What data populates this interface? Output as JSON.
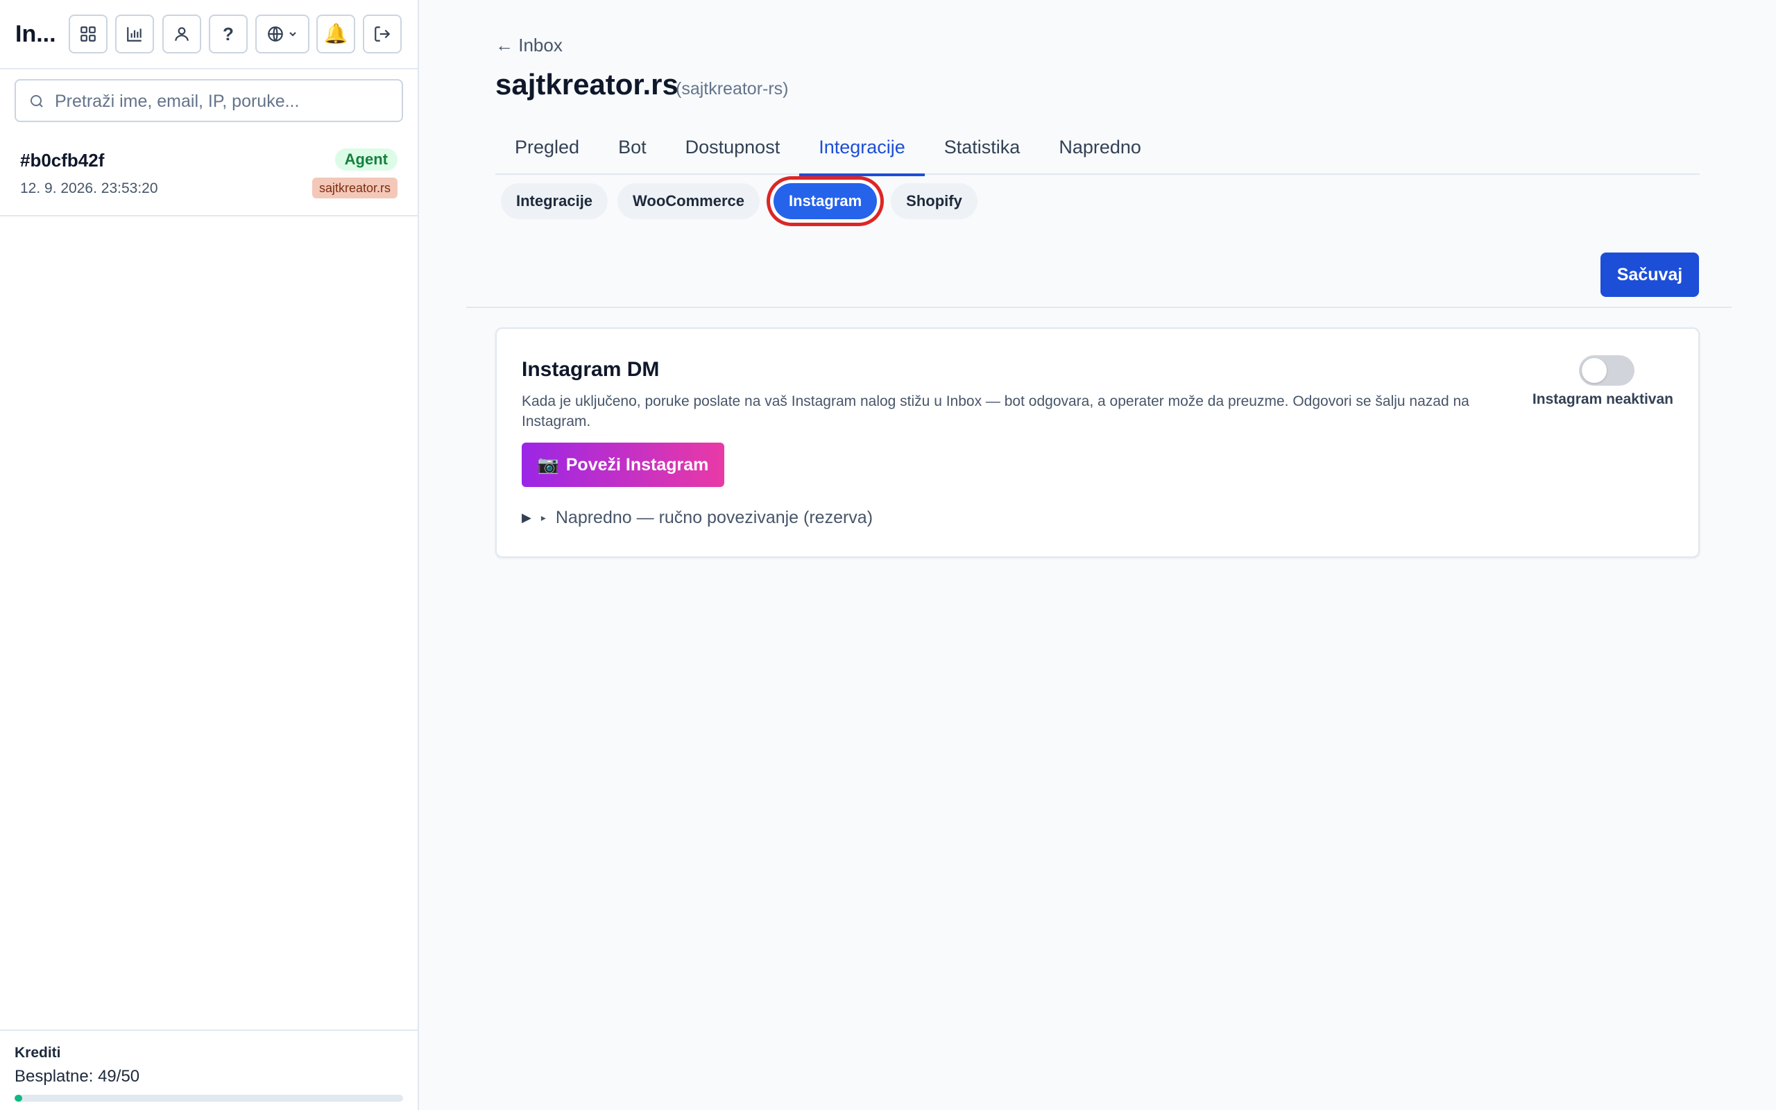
{
  "sidebar": {
    "title": "In...",
    "search_placeholder": "Pretraži ime, email, IP, poruke...",
    "conversation": {
      "id": "#b0cfb42f",
      "timestamp": "12. 9. 2026. 23:53:20",
      "status_badge": "Agent",
      "site_badge": "sajtkreator.rs"
    },
    "credits": {
      "label": "Krediti",
      "value_text": "Besplatne: 49/50",
      "used": 1,
      "total": 50
    }
  },
  "header": {
    "back_label": "← Inbox",
    "title": "sajtkreator.rs",
    "slug": "(sajtkreator-rs)"
  },
  "tabs": [
    {
      "label": "Pregled",
      "active": false
    },
    {
      "label": "Bot",
      "active": false
    },
    {
      "label": "Dostupnost",
      "active": false
    },
    {
      "label": "Integracije",
      "active": true
    },
    {
      "label": "Statistika",
      "active": false
    },
    {
      "label": "Napredno",
      "active": false
    }
  ],
  "subtabs": [
    {
      "label": "Integracije",
      "active": false
    },
    {
      "label": "WooCommerce",
      "active": false
    },
    {
      "label": "Instagram",
      "active": true
    },
    {
      "label": "Shopify",
      "active": false
    }
  ],
  "save_label": "Sačuvaj",
  "instagram": {
    "title": "Instagram DM",
    "description": "Kada je uključeno, poruke poslate na vaš Instagram nalog stižu u Inbox — bot odgovara, a operater može da preuzme. Odgovori se šalju nazad na Instagram.",
    "toggle_on": false,
    "status_label": "Instagram neaktivan",
    "connect_label": "Poveži Instagram",
    "connect_emoji": "📷",
    "advanced_label": "Napredno — ručno povezivanje (rezerva)"
  },
  "colors": {
    "accent": "#1d4ed8",
    "highlight_ring": "#dc2626",
    "agent_badge_bg": "#dcfce7",
    "site_badge_bg": "#f3c8b8",
    "progress": "#10b981",
    "instagram_gradient_start": "#9b26e6",
    "instagram_gradient_end": "#e93aa6"
  },
  "icons": [
    "grid-icon",
    "chart-icon",
    "user-icon",
    "help-icon",
    "globe-icon",
    "chevron-down-icon",
    "bell-icon",
    "logout-icon",
    "search-icon",
    "caret-right-icon"
  ]
}
